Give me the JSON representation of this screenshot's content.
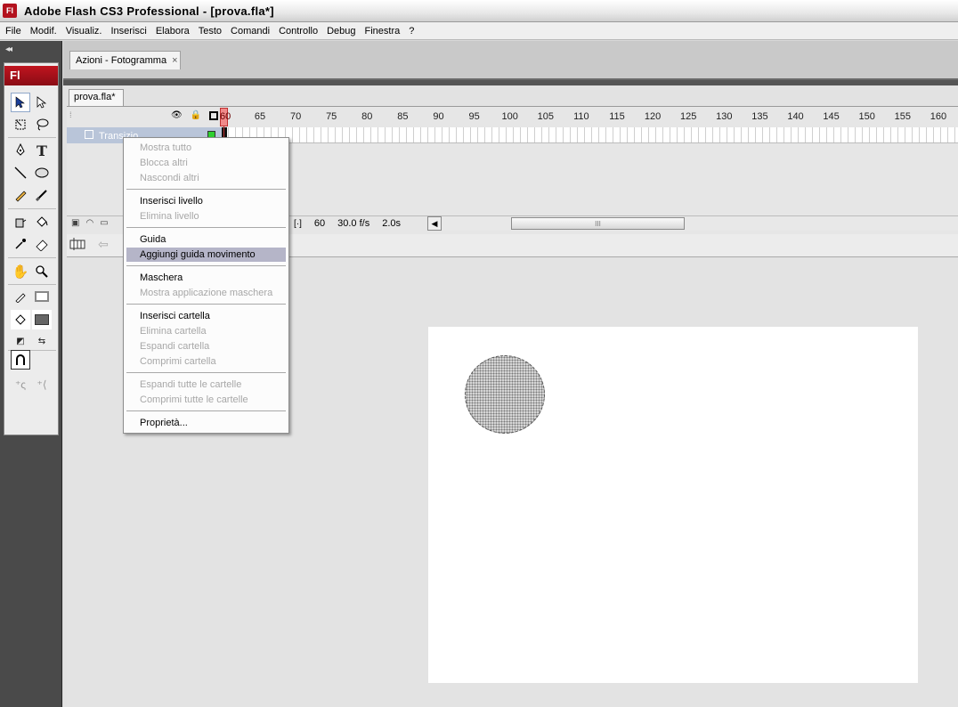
{
  "window": {
    "app_icon": "Fl",
    "title": "Adobe Flash CS3 Professional - [prova.fla*]"
  },
  "menubar": {
    "items": [
      "File",
      "Modif.",
      "Visualiz.",
      "Inserisci",
      "Elabora",
      "Testo",
      "Comandi",
      "Controllo",
      "Debug",
      "Finestra",
      "?"
    ]
  },
  "panels": {
    "collapse_label": "◂◂",
    "actions_tab": "Azioni - Fotogramma",
    "actions_close": "×"
  },
  "tools": {
    "logo": "Fl"
  },
  "document": {
    "tab": "prova.fla*"
  },
  "timeline": {
    "playhead_frame": "60",
    "ruler_labels": [
      "65",
      "70",
      "75",
      "80",
      "85",
      "90",
      "95",
      "100",
      "105",
      "110",
      "115",
      "120",
      "125",
      "130",
      "135",
      "140",
      "145",
      "150",
      "155",
      "160"
    ],
    "layer_name": "Transizio",
    "current_frame": "60",
    "frame_rate": "30.0 f/s",
    "elapsed_time": "2.0s",
    "scroll_thumb_glyph": "III"
  },
  "context_menu": {
    "items": [
      {
        "label": "Mostra tutto",
        "enabled": false
      },
      {
        "label": "Blocca altri",
        "enabled": false
      },
      {
        "label": "Nascondi altri",
        "enabled": false
      },
      {
        "label": "Inserisci livello",
        "enabled": true
      },
      {
        "label": "Elimina livello",
        "enabled": false
      },
      {
        "label": "Guida",
        "enabled": true
      },
      {
        "label": "Aggiungi guida movimento",
        "enabled": true,
        "highlighted": true
      },
      {
        "label": "Maschera",
        "enabled": true
      },
      {
        "label": "Mostra applicazione maschera",
        "enabled": false
      },
      {
        "label": "Inserisci cartella",
        "enabled": true
      },
      {
        "label": "Elimina cartella",
        "enabled": false
      },
      {
        "label": "Espandi cartella",
        "enabled": false
      },
      {
        "label": "Comprimi cartella",
        "enabled": false
      },
      {
        "label": "Espandi tutte le cartelle",
        "enabled": false
      },
      {
        "label": "Comprimi tutte le cartelle",
        "enabled": false
      },
      {
        "label": "Proprietà...",
        "enabled": true
      }
    ]
  },
  "colors": {
    "brand_red": "#b3121e",
    "menu_highlight": "#b5b5c8",
    "keyframe_green": "#2fcf2f"
  }
}
